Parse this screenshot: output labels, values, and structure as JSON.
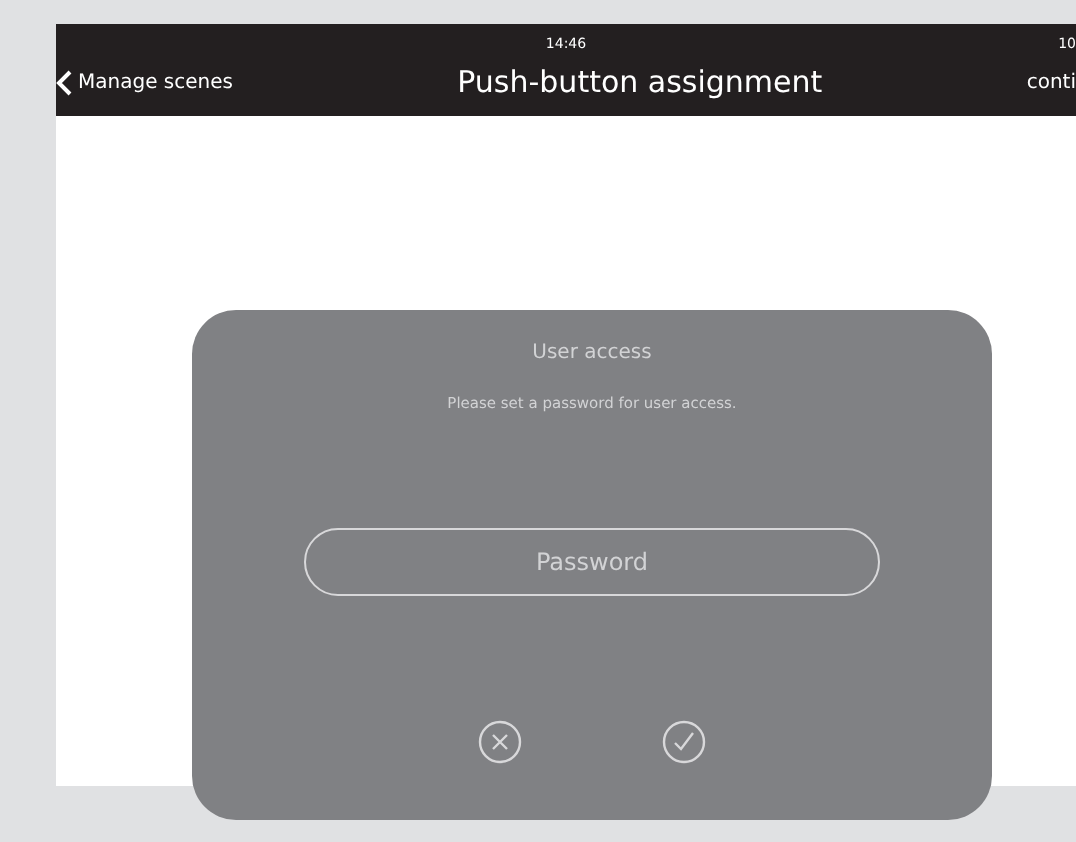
{
  "status_bar": {
    "time": "14:46",
    "battery": "10"
  },
  "header": {
    "back": "Manage scenes",
    "title": "Push-button assignment",
    "action": "conti"
  },
  "dialog": {
    "title": "User access",
    "message": "Please set a password for user access.",
    "password": {
      "placeholder": "Password"
    }
  }
}
